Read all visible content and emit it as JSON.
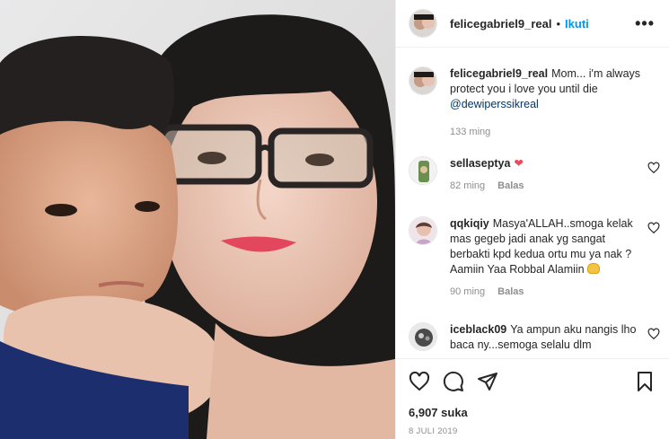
{
  "post": {
    "author": "felicegabriel9_real",
    "separator": "•",
    "follow_label": "Ikuti",
    "more_label": "•••",
    "caption": {
      "username": "felicegabriel9_real",
      "text": "Mom... i'm always protect you i love you until die",
      "mention": "@dewiperssikreal",
      "time": "133 ming"
    },
    "comments": [
      {
        "username": "sellaseptya",
        "text": "",
        "emoji": "❤",
        "time": "82 ming",
        "reply_label": "Balas"
      },
      {
        "username": "qqkiqiy",
        "text": "Masya'ALLAH..smoga kelak mas gegeb jadi anak yg sangat berbakti kpd kedua ortu mu ya nak ? Aamiin Yaa Robbal Alamiin",
        "time": "90 ming",
        "reply_label": "Balas"
      },
      {
        "username": "iceblack09",
        "text": "Ya ampun aku nangis lho baca ny...semoga selalu dlm",
        "time": "",
        "reply_label": ""
      }
    ],
    "likes": "6,907 suka",
    "date": "8 JULI 2019"
  },
  "icons": {
    "like": "heart-icon",
    "comment": "comment-icon",
    "share": "send-icon",
    "save": "bookmark-icon",
    "comment_like": "heart-outline-icon"
  },
  "colors": {
    "accent": "#0095f6",
    "text": "#262626",
    "muted": "#8e8e8e",
    "mention": "#00376b",
    "heart": "#ed4956"
  }
}
